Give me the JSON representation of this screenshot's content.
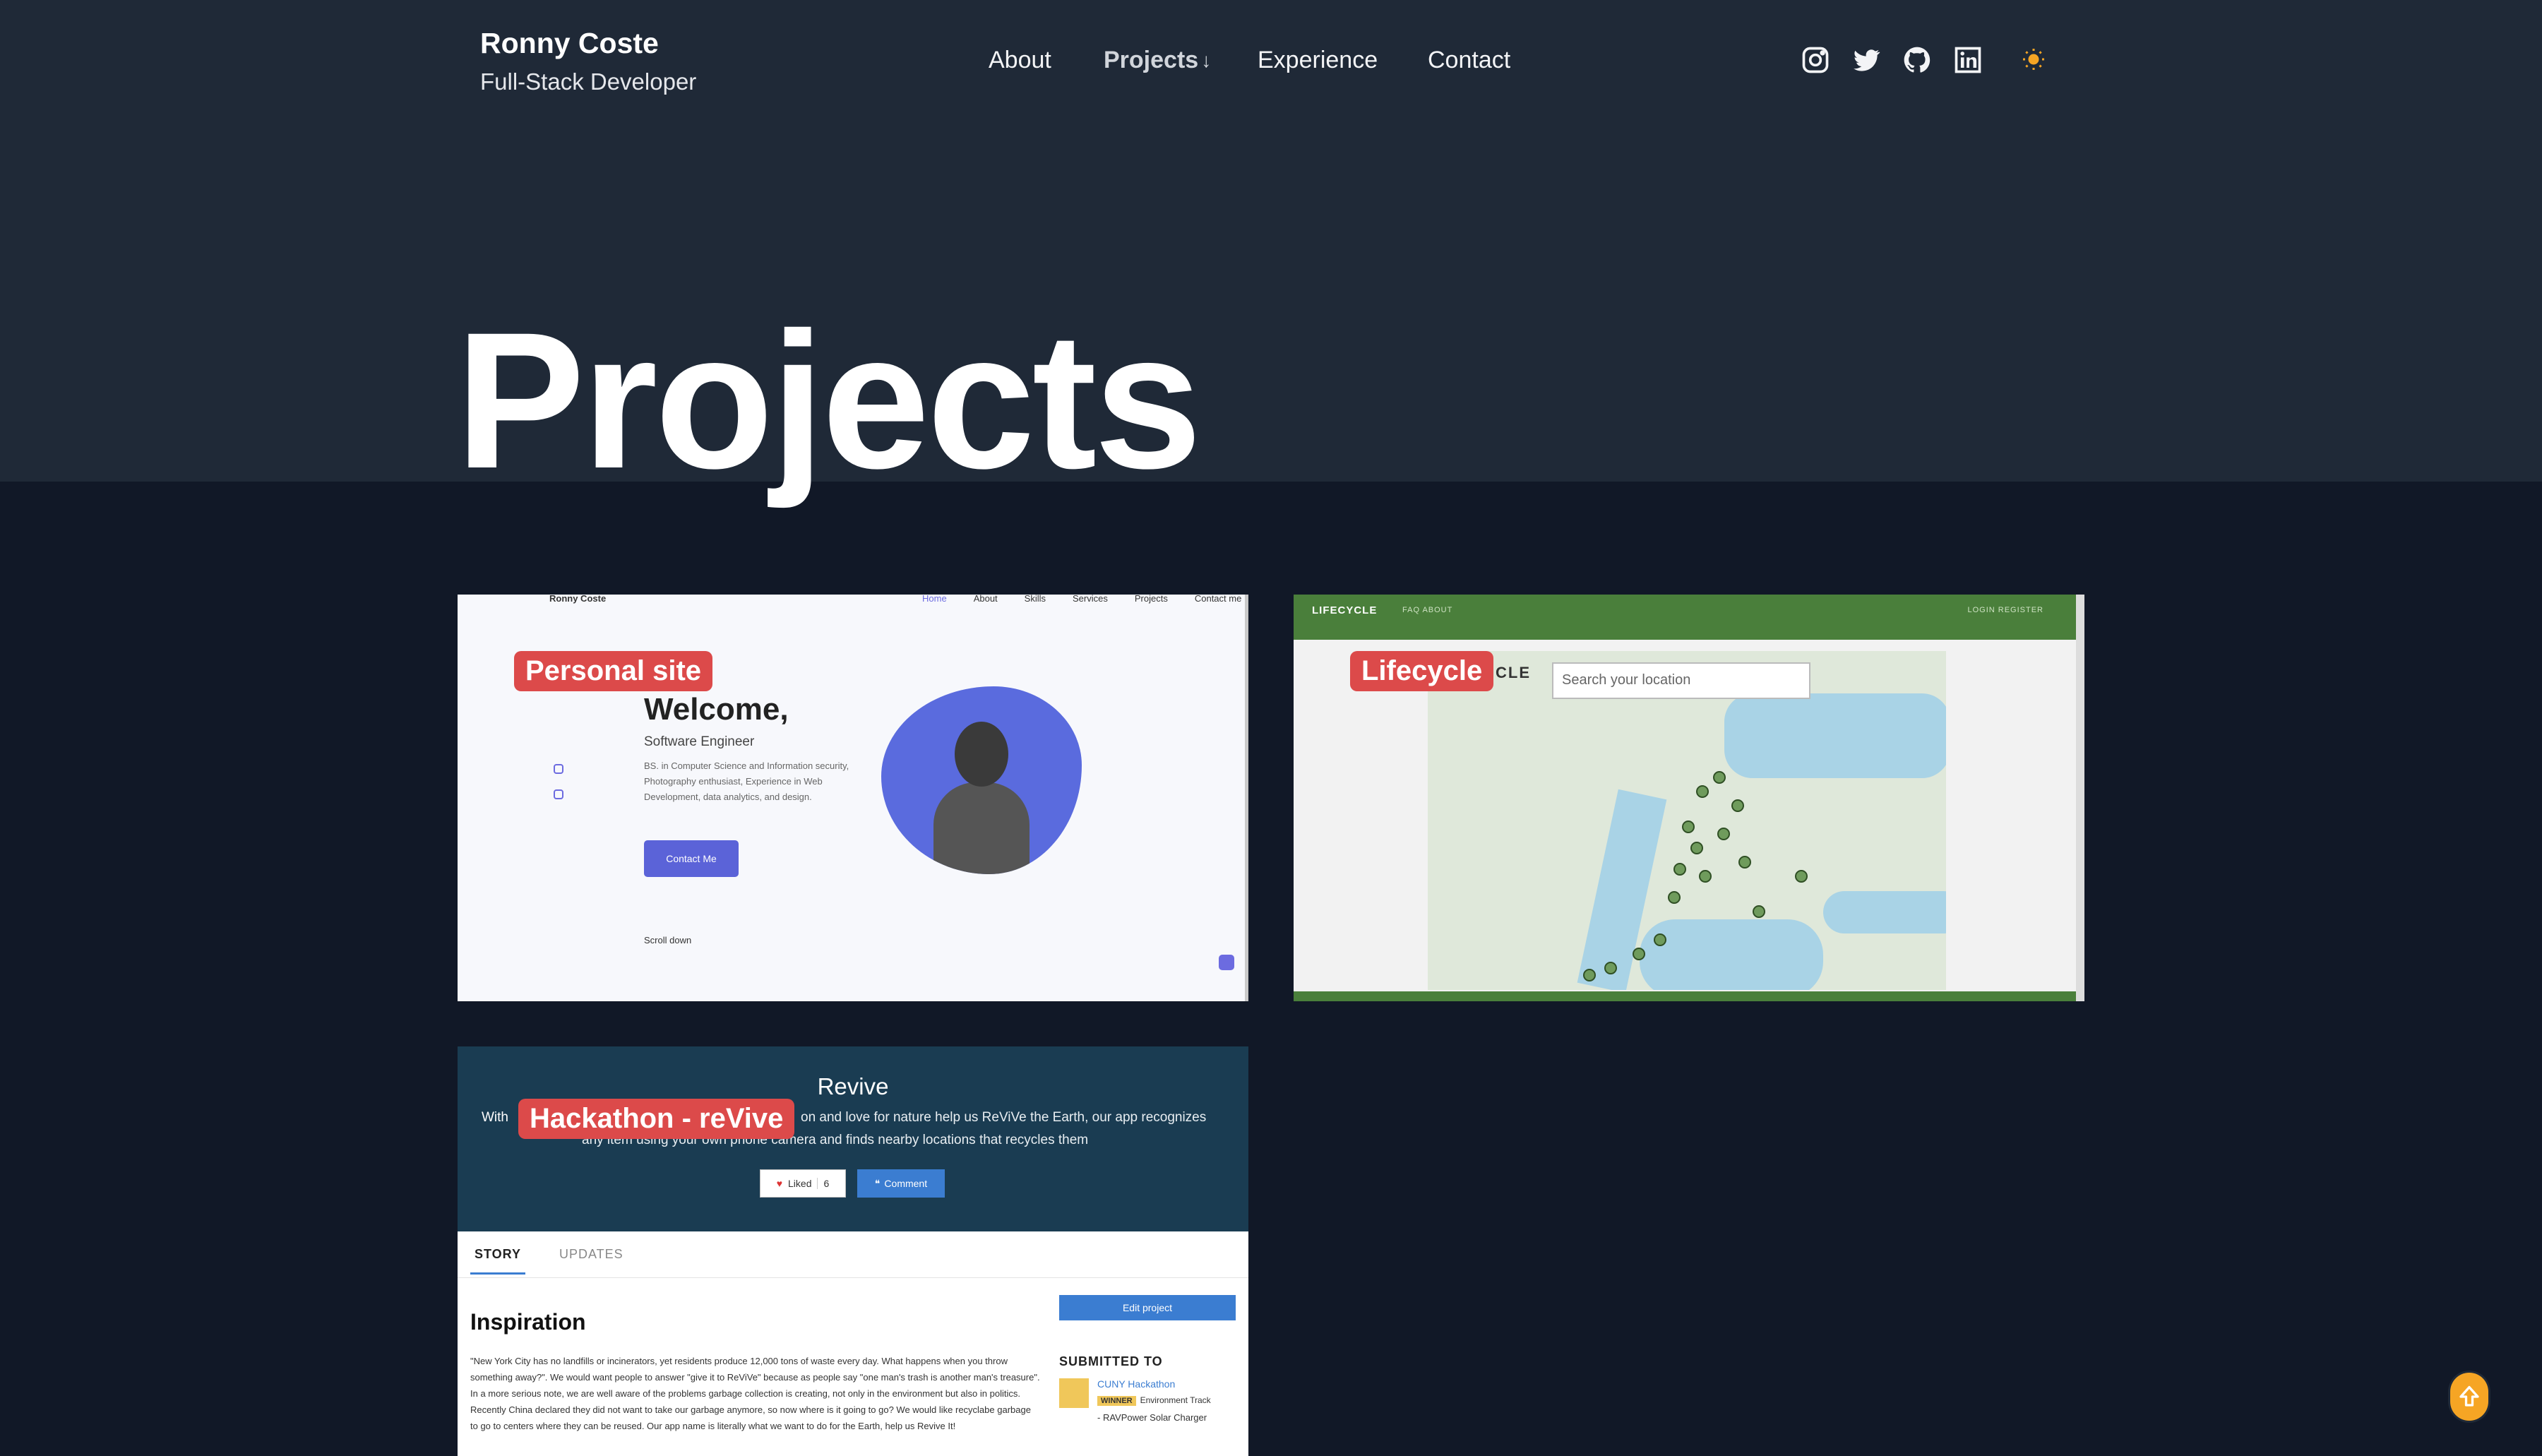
{
  "brand": {
    "name": "Ronny Coste",
    "role": "Full-Stack Developer"
  },
  "nav": {
    "about": "About",
    "projects": "Projects",
    "projects_arrow": "↓",
    "experience": "Experience",
    "contact": "Contact"
  },
  "theme_toggle": "☀",
  "page_title": "Projects",
  "cards": {
    "personal": {
      "label": "Personal site",
      "site_name": "Ronny Coste",
      "nav_links": [
        "Home",
        "About",
        "Skills",
        "Services",
        "Projects",
        "Contact me"
      ],
      "heading": "Welcome,",
      "role": "Software Engineer",
      "description": "BS. in Computer Science and Information security, Photography enthusiast, Experience in Web Development, data analytics, and design.",
      "cta": "Contact Me",
      "scroll": "Scroll down"
    },
    "lifecycle": {
      "label": "Lifecycle",
      "logo": "LIFECYCLE",
      "links": "FAQ  ABOUT",
      "auth": "LOGIN   REGISTER",
      "ghost": "CLE",
      "search_placeholder": "Search your location"
    },
    "revive": {
      "label": "Hackathon - reVive",
      "title": "Revive",
      "sub_start": "With",
      "sub_mid": "on and love for nature help us ReViVe the Earth, our app recognizes",
      "sub_end": "any item using your own phone camera and finds nearby locations that recycles them",
      "liked": "Liked",
      "liked_count": "6",
      "comment": "Comment",
      "tab_story": "STORY",
      "tab_updates": "UPDATES",
      "inspiration": "Inspiration",
      "story": "\"New York City has no landfills or incinerators, yet residents produce 12,000 tons of waste every day. What happens when you throw something away?\". We would want people to answer \"give it to ReViVe\" because as people say \"one man's trash is another man's treasure\". In a more serious note, we are well aware of the problems garbage collection is creating, not only in the environment but also in politics. Recently China declared they did not want to take our garbage anymore, so now where is it going to go? We would like recyclabe garbage to go to centers where they can be reused. Our app name is literally what we want to do for the Earth, help us Revive It!",
      "edit": "Edit project",
      "submitted": "SUBMITTED TO",
      "hackathon": "CUNY Hackathon",
      "winner_badge": "WINNER",
      "winner_track": "Environment Track",
      "prize": "- RAVPower Solar Charger"
    }
  },
  "colors": {
    "background": "#111827",
    "header": "#1f2937",
    "label": "#dc4a4a",
    "accent": "#f6a524"
  }
}
